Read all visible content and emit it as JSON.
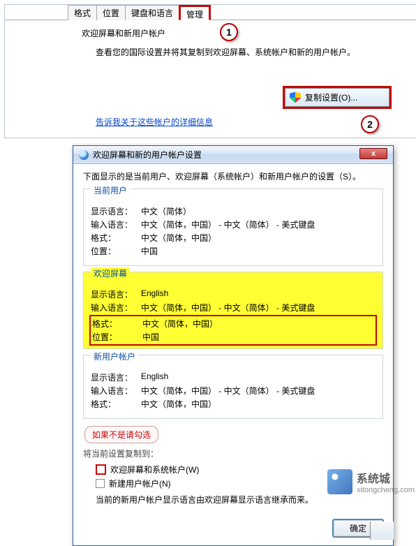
{
  "top": {
    "tabs": {
      "format": "格式",
      "location": "位置",
      "keyboard": "键盘和语言",
      "admin": "管理"
    },
    "heading": "欢迎屏幕和新用户帐户",
    "desc": "查看您的国际设置并将其复制到欢迎屏幕、系统帐户和新的用户帐户。",
    "copy_button": "复制设置(O)...",
    "link": "告诉我关于这些帐户的详细信息",
    "marker1": "1",
    "marker2": "2"
  },
  "dialog": {
    "title": "欢迎屏幕和新的用户帐户设置",
    "close": "x",
    "intro": "下面显示的是当前用户、欢迎屏幕（系统帐户）和新用户帐户的设置（S）。",
    "labels": {
      "display_lang": "显示语言：",
      "input_lang": "输入语言：",
      "format": "格式：",
      "location": "位置："
    },
    "groups": {
      "current": {
        "legend": "当前用户",
        "display_lang": "中文（简体）",
        "input_lang": "中文（简体，中国） - 中文（简体） - 美式键盘",
        "format": "中文（简体，中国）",
        "location": "中国"
      },
      "welcome": {
        "legend": "欢迎屏幕",
        "display_lang": "English",
        "input_lang": "中文（简体，中国） - 中文（简体） - 美式键盘",
        "format": "中文（简体，中国）",
        "location": "中国"
      },
      "new_user": {
        "legend": "新用户帐户",
        "display_lang": "English",
        "input_lang": "中文（简体，中国） - 中文（简体） - 美式键盘",
        "format": "中文（简体，中国）"
      }
    },
    "note": "如果不是请勾选",
    "copy_to_title": "将当前设置复制到：",
    "cb_welcome": "欢迎屏幕和系统帐户(W)",
    "cb_newuser": "新建用户帐户(N)",
    "inherit": "当前的新用户帐户显示语言由欢迎屏幕显示语言继承而来。",
    "ok": "确定",
    "cancel_symbol": "▯"
  },
  "watermark": {
    "brand": "系统城",
    "url": "xitongcheng.com"
  }
}
